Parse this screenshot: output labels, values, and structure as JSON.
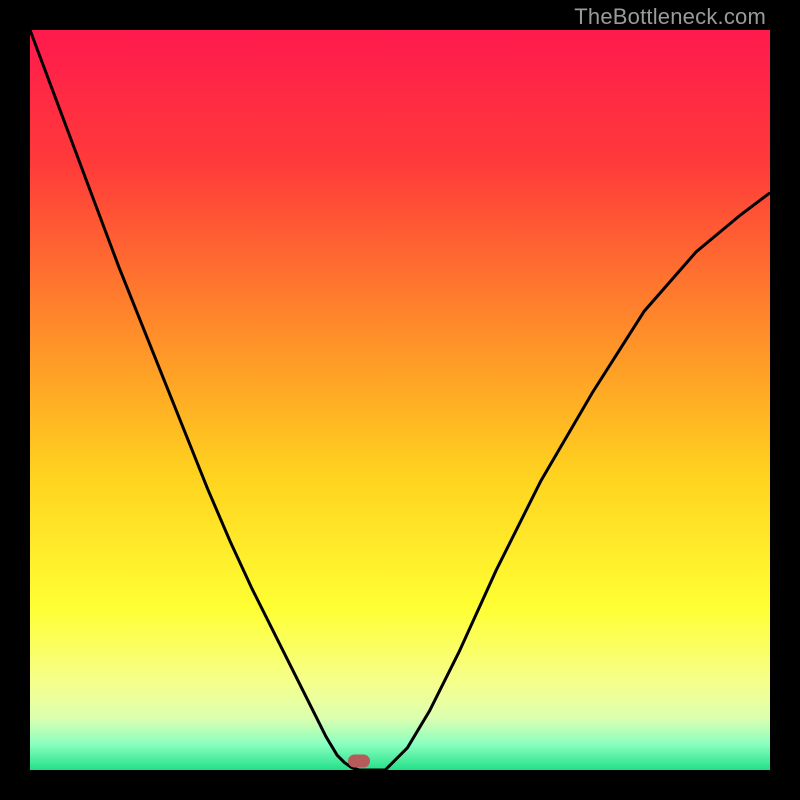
{
  "watermark": {
    "text": "TheBottleneck.com"
  },
  "chart_data": {
    "type": "line",
    "title": "",
    "xlabel": "",
    "ylabel": "",
    "xlim": [
      0,
      1
    ],
    "ylim": [
      0,
      1
    ],
    "grid": false,
    "legend": false,
    "background_gradient_stops": [
      {
        "offset": 0.0,
        "color": "#ff1a4d"
      },
      {
        "offset": 0.18,
        "color": "#ff3a3a"
      },
      {
        "offset": 0.4,
        "color": "#ff8a2a"
      },
      {
        "offset": 0.6,
        "color": "#ffd21f"
      },
      {
        "offset": 0.78,
        "color": "#ffff33"
      },
      {
        "offset": 0.88,
        "color": "#f6ff8a"
      },
      {
        "offset": 0.93,
        "color": "#dcffb0"
      },
      {
        "offset": 0.965,
        "color": "#8affc0"
      },
      {
        "offset": 1.0,
        "color": "#23e089"
      }
    ],
    "series": [
      {
        "name": "bottleneck-curve",
        "color": "#000000",
        "x": [
          0.0,
          0.03,
          0.06,
          0.09,
          0.12,
          0.15,
          0.18,
          0.21,
          0.24,
          0.27,
          0.3,
          0.33,
          0.355,
          0.38,
          0.4,
          0.415,
          0.425,
          0.435,
          0.445,
          0.46,
          0.48,
          0.51,
          0.54,
          0.58,
          0.63,
          0.69,
          0.76,
          0.83,
          0.9,
          0.96,
          1.0
        ],
        "y": [
          1.0,
          0.92,
          0.84,
          0.76,
          0.68,
          0.605,
          0.53,
          0.455,
          0.38,
          0.31,
          0.245,
          0.185,
          0.135,
          0.085,
          0.045,
          0.02,
          0.01,
          0.003,
          0.0,
          0.0,
          0.0,
          0.03,
          0.08,
          0.16,
          0.27,
          0.39,
          0.51,
          0.62,
          0.7,
          0.75,
          0.78
        ]
      }
    ],
    "marker": {
      "x": 0.445,
      "y": 0.012,
      "color": "#b65a5a"
    }
  }
}
